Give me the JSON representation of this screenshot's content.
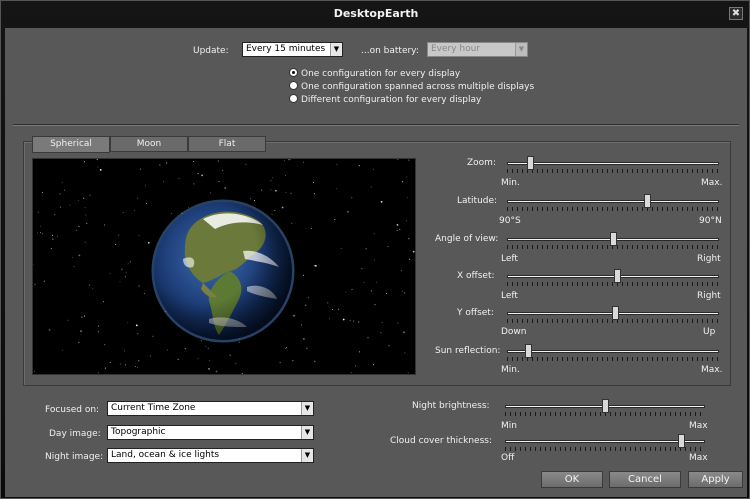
{
  "window": {
    "title": "DesktopEarth",
    "close_glyph": "✖"
  },
  "top": {
    "update_label": "Update:",
    "update_value": "Every 15 minutes",
    "battery_label": "...on battery:",
    "battery_value": "Every hour",
    "radios": [
      {
        "label": "One configuration for every display",
        "selected": true
      },
      {
        "label": "One configuration spanned across multiple displays",
        "selected": false
      },
      {
        "label": "Different configuration for every display",
        "selected": false
      }
    ]
  },
  "tabs": [
    {
      "label": "Spherical",
      "active": true
    },
    {
      "label": "Moon",
      "active": false
    },
    {
      "label": "Flat",
      "active": false
    }
  ],
  "sliders": {
    "zoom": {
      "label": "Zoom:",
      "min": "Min.",
      "max": "Max.",
      "value": 0.11
    },
    "latitude": {
      "label": "Latitude:",
      "min": "90°S",
      "max": "90°N",
      "value": 0.66
    },
    "angle": {
      "label": "Angle of view:",
      "min": "Left",
      "max": "Right",
      "value": 0.5
    },
    "xoffset": {
      "label": "X offset:",
      "min": "Left",
      "max": "Right",
      "value": 0.52
    },
    "yoffset": {
      "label": "Y offset:",
      "min": "Down",
      "max": "Up",
      "value": 0.51
    },
    "sun": {
      "label": "Sun reflection:",
      "min": "Min.",
      "max": "Max.",
      "value": 0.1
    }
  },
  "bottom": {
    "focused_label": "Focused on:",
    "focused_value": "Current Time Zone",
    "day_label": "Day image:",
    "day_value": "Topographic",
    "night_label": "Night image:",
    "night_value": "Land, ocean & ice lights",
    "night_brightness": {
      "label": "Night brightness:",
      "min": "Min",
      "max": "Max",
      "value": 0.5
    },
    "cloud_cover": {
      "label": "Cloud cover thickness:",
      "min": "Off",
      "max": "Max",
      "value": 0.88
    }
  },
  "buttons": {
    "ok": "OK",
    "cancel": "Cancel",
    "apply": "Apply"
  },
  "icons": {
    "dropdown": "chevron-down-icon",
    "close": "close-icon"
  }
}
